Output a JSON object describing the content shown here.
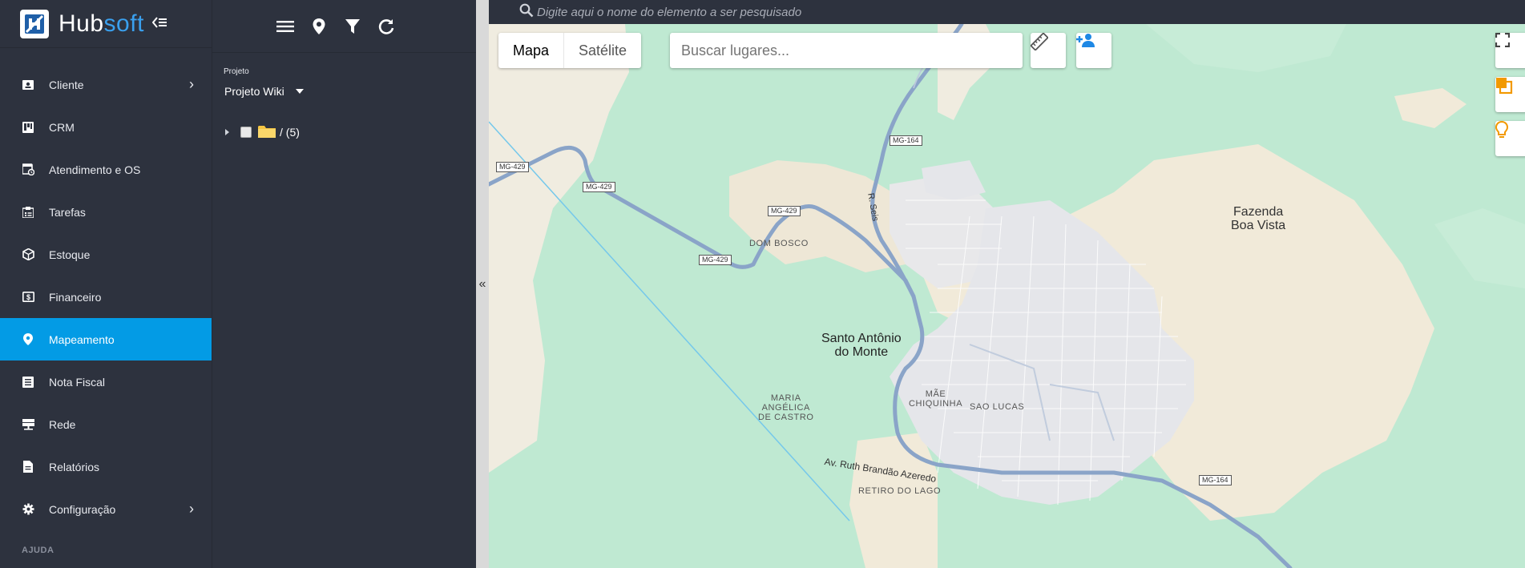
{
  "brand": {
    "name_part1": "Hub",
    "name_part2": "soft"
  },
  "nav": {
    "items": [
      {
        "label": "Cliente",
        "icon": "contact-card-icon",
        "has_children": true
      },
      {
        "label": "CRM",
        "icon": "kanban-icon",
        "has_children": false
      },
      {
        "label": "Atendimento e OS",
        "icon": "calendar-clock-icon",
        "has_children": false
      },
      {
        "label": "Tarefas",
        "icon": "tasks-icon",
        "has_children": false
      },
      {
        "label": "Estoque",
        "icon": "box-icon",
        "has_children": false
      },
      {
        "label": "Financeiro",
        "icon": "money-icon",
        "has_children": false
      },
      {
        "label": "Mapeamento",
        "icon": "map-pin-icon",
        "has_children": false,
        "active": true
      },
      {
        "label": "Nota Fiscal",
        "icon": "invoice-icon",
        "has_children": false
      },
      {
        "label": "Rede",
        "icon": "network-icon",
        "has_children": false
      },
      {
        "label": "Relatórios",
        "icon": "report-icon",
        "has_children": false
      },
      {
        "label": "Configuração",
        "icon": "gear-icon",
        "has_children": true
      }
    ],
    "section_label": "AJUDA"
  },
  "panel": {
    "project_label": "Projeto",
    "project_value": "Projeto Wiki",
    "tree_root_label": "/ (5)"
  },
  "search": {
    "placeholder": "Digite aqui o nome do elemento a ser pesquisado"
  },
  "map": {
    "type_options": [
      "Mapa",
      "Satélite"
    ],
    "type_selected": "Mapa",
    "place_search_placeholder": "Buscar lugares...",
    "labels": {
      "city": "Santo Antônio do Monte",
      "city_line1": "Santo Antônio",
      "city_line2": "do Monte",
      "farm_line1": "Fazenda",
      "farm_line2": "Boa Vista",
      "dom_bosco": "DOM BOSCO",
      "mae_line1": "MÃE",
      "mae_line2": "CHIQUINHA",
      "maria_line1": "MARIA",
      "maria_line2": "ANGÉLICA",
      "maria_line3": "DE CASTRO",
      "sao_lucas": "SAO LUCAS",
      "retiro": "RETIRO DO LAGO",
      "street_ruth": "Av. Ruth Brandão Azeredo",
      "street_seis": "R. Seis"
    },
    "road_shields": [
      "MG-429",
      "MG-429",
      "MG-429",
      "MG-429",
      "MG-164",
      "MG-164"
    ]
  },
  "colors": {
    "accent": "#039be5",
    "sidebar_bg": "#2d323e",
    "brand_soft": "#3aa0ee",
    "orange": "#f29900"
  }
}
